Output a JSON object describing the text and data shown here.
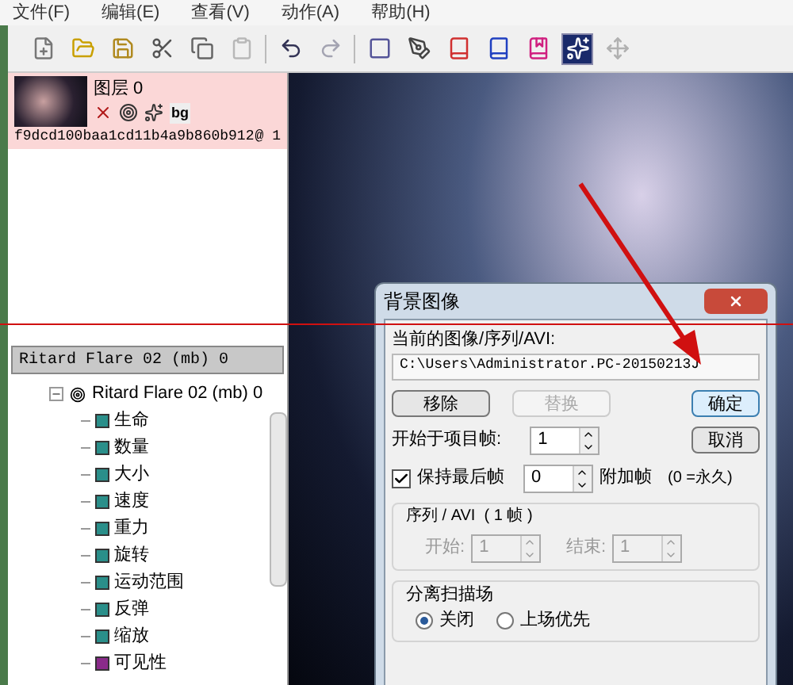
{
  "menu": [
    "文件(F)",
    "编辑(E)",
    "查看(V)",
    "动作(A)",
    "帮助(H)"
  ],
  "tools": [
    {
      "kind": "new",
      "selected": false,
      "disabled": false
    },
    {
      "kind": "open",
      "selected": false,
      "disabled": false
    },
    {
      "kind": "save",
      "selected": false,
      "disabled": false
    },
    {
      "kind": "cut",
      "selected": false,
      "disabled": false
    },
    {
      "kind": "copy",
      "selected": false,
      "disabled": false
    },
    {
      "kind": "paste",
      "selected": false,
      "disabled": true
    },
    {
      "kind": "undo",
      "selected": false,
      "disabled": false
    },
    {
      "kind": "redo",
      "selected": false,
      "disabled": true
    },
    {
      "kind": "frame",
      "selected": false,
      "disabled": false
    },
    {
      "kind": "pen",
      "selected": false,
      "disabled": false
    },
    {
      "kind": "book-red",
      "selected": false,
      "disabled": false
    },
    {
      "kind": "book-blue",
      "selected": false,
      "disabled": false
    },
    {
      "kind": "book-pink",
      "selected": false,
      "disabled": false
    },
    {
      "kind": "stars",
      "selected": true,
      "disabled": false
    },
    {
      "kind": "move",
      "selected": false,
      "disabled": true
    }
  ],
  "layer": {
    "title": "图层 0",
    "tag": "bg",
    "id": "f9dcd100baa1cd11b4a9b860b912",
    "suffix": "@ 1",
    "selected": true
  },
  "tree": {
    "header": "Ritard Flare 02 (mb) 0",
    "root": {
      "label": "Ritard Flare 02 (mb) 0",
      "expanded": true,
      "children": [
        {
          "label": "生命",
          "color": "#2a8f8a"
        },
        {
          "label": "数量",
          "color": "#2a8f8a"
        },
        {
          "label": "大小",
          "color": "#2a8f8a"
        },
        {
          "label": "速度",
          "color": "#2a8f8a"
        },
        {
          "label": "重力",
          "color": "#2a8f8a"
        },
        {
          "label": "旋转",
          "color": "#2a8f8a"
        },
        {
          "label": "运动范围",
          "color": "#2a8f8a"
        },
        {
          "label": "反弹",
          "color": "#2a8f8a"
        },
        {
          "label": "缩放",
          "color": "#2a8f8a"
        },
        {
          "label": "可见性",
          "color": "#8a2a8a"
        }
      ]
    }
  },
  "dialog": {
    "title": "背景图像",
    "path_label": "当前的图像/序列/AVI:",
    "path": "C:\\Users\\Administrator.PC-20150213J",
    "buttons": [
      {
        "label": "移除",
        "disabled": false
      },
      {
        "label": "替换",
        "disabled": true
      }
    ],
    "ok": "确定",
    "cancel": "取消",
    "start_label": "开始于项目帧:",
    "start_value": "1",
    "hold": {
      "label": "保持最后帧",
      "checked": true,
      "value": "0",
      "suffix": "附加帧",
      "note": "(0 =永久)"
    },
    "sequence": {
      "title": "序列 / AVI  ( 1 帧 )",
      "disabled": true,
      "start_label": "开始:",
      "start_value": "1",
      "end_label": "结束:",
      "end_value": "1"
    },
    "fields": {
      "title": "分离扫描场",
      "options": [
        {
          "label": "关闭",
          "selected": true
        },
        {
          "label": "上场优先",
          "selected": false
        }
      ]
    }
  }
}
